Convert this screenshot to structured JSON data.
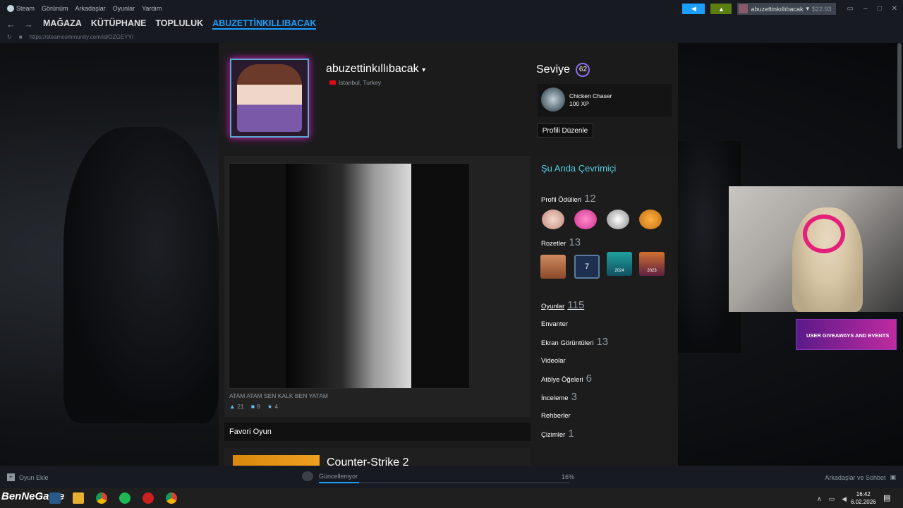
{
  "topbar": {
    "menu": [
      "Steam",
      "Görünüm",
      "Arkadaşlar",
      "Oyunlar",
      "Yardım"
    ],
    "account_name": "abuzettinkıllıbacak",
    "wallet": "$22.93"
  },
  "nav": {
    "back_icon": "arrow-left-icon",
    "forward_icon": "arrow-right-icon",
    "tabs": [
      "MAĞAZA",
      "KÜTÜPHANE",
      "TOPLULUK",
      "ABUZETTİNKILLIBACAK"
    ],
    "active_tab": "ABUZETTİNKILLIBACAK",
    "url": "https://steamcommunity.com/id/OZGEYY/"
  },
  "profile": {
    "username": "abuzettinkıllıbacak",
    "location": "Istanbul, Turkey",
    "level_label": "Seviye",
    "level": "62",
    "badge_name": "Chicken Chaser",
    "badge_xp": "100 XP",
    "edit_button": "Profili Düzenle"
  },
  "showcase": {
    "artwork_title": "ATAM ATAM SEN KALK BEN YATAM",
    "likes": "21",
    "comments": "8",
    "awards": "4"
  },
  "favorite": {
    "heading": "Favori Oyun",
    "game_title": "Counter-Strike 2"
  },
  "sidebar": {
    "status": "Şu Anda Çevrimiçi",
    "items": [
      {
        "label": "Profil Ödülleri",
        "count": "12"
      },
      {
        "label": "Rozetler",
        "count": "13"
      },
      {
        "label": "Oyunlar",
        "count": "115"
      },
      {
        "label": "Envanter",
        "count": ""
      },
      {
        "label": "Ekran Görüntüleri",
        "count": "13"
      },
      {
        "label": "Videolar",
        "count": ""
      },
      {
        "label": "Atölye Öğeleri",
        "count": "6"
      },
      {
        "label": "İnceleme",
        "count": "3"
      },
      {
        "label": "Rehberler",
        "count": ""
      },
      {
        "label": "Çizimler",
        "count": "1"
      }
    ],
    "badge_years": [
      "2024",
      "2023"
    ],
    "badge_number": "7"
  },
  "overlay": {
    "giveaway_text": "USER GIVEAWAYS AND EVENTS"
  },
  "bottombar": {
    "add_game": "Oyun Ekle",
    "download_status": "Güncelleniyor",
    "download_progress": "16%",
    "download_fraction": 0.16,
    "friends_chat": "Arkadaşlar ve Sohbet"
  },
  "taskbar": {
    "watermark": "BenNeGame",
    "time": "16:42",
    "date": "6.02.2026"
  }
}
